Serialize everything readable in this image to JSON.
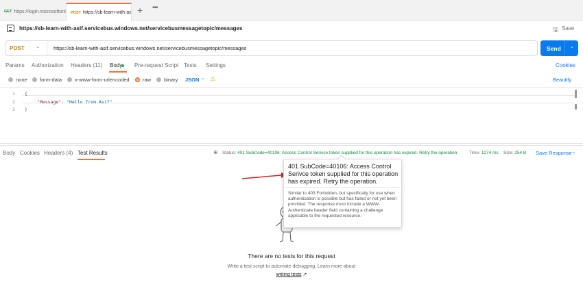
{
  "tabs": [
    {
      "method": "GET",
      "label": "https://login.microsoftonl"
    },
    {
      "method": "POST",
      "label": "https://sb-learn-with-as"
    }
  ],
  "tab_add": "+",
  "tab_more": "•••",
  "request": {
    "title": "https://sb-learn-with-asif.servicebus.windows.net/servicebusmessagetopic/messages",
    "save_label": "Save",
    "method": "POST",
    "url": "https://sb-learn-with-asif.servicebus.windows.net/servicebusmessagetopic/messages",
    "send_label": "Send"
  },
  "request_tabs": {
    "params": "Params",
    "authorization": "Authorization",
    "headers": "Headers (11)",
    "body": "Body",
    "prerequest": "Pre-request Script",
    "tests": "Tests",
    "settings": "Settings",
    "cookies": "Cookies"
  },
  "body_types": {
    "none": "none",
    "form_data": "form-data",
    "urlencoded": "x-www-form-urlencoded",
    "raw": "raw",
    "binary": "binary",
    "format": "JSON",
    "beautify": "Beautify"
  },
  "editor": {
    "line_numbers": [
      "1",
      "2",
      "3"
    ],
    "line1": "{",
    "line2_key": "\"Message\"",
    "line2_colon": ": ",
    "line2_value": "\"Hello from Asif\"",
    "line3": "}"
  },
  "response_tabs": {
    "body": "Body",
    "cookies": "Cookies",
    "headers": "Headers (4)",
    "test_results": "Test Results"
  },
  "response_meta": {
    "status_label": "Status:",
    "status_value": "401 SubCode=40106: Access Control Serivce token supplied for this operation has expired. Retry the operation.",
    "time_label": "Time:",
    "time_value": "1274 ms",
    "size_label": "Size:",
    "size_value": "254 B",
    "save_response": "Save Response"
  },
  "tooltip": {
    "title": "401 SubCode=40106: Access Control Serivce token supplied for this operation has expired. Retry the operation.",
    "description": "Similar to 403 Forbidden, but specifically for use when authentication is possible but has failed or not yet been provided. The response must include a WWW-Authenticate header field containing a challenge applicable to the requested resource."
  },
  "empty_state": {
    "title": "There are no tests for this request",
    "subtitle": "Write a test script to automate debugging. Learn more about",
    "link": "writing tests",
    "link_arrow": "↗"
  },
  "colors": {
    "accent": "#ff6c37",
    "primary": "#097bed",
    "success": "#0f8a3a",
    "post_method": "#c7860a",
    "annotation_arrow": "#d62020"
  }
}
